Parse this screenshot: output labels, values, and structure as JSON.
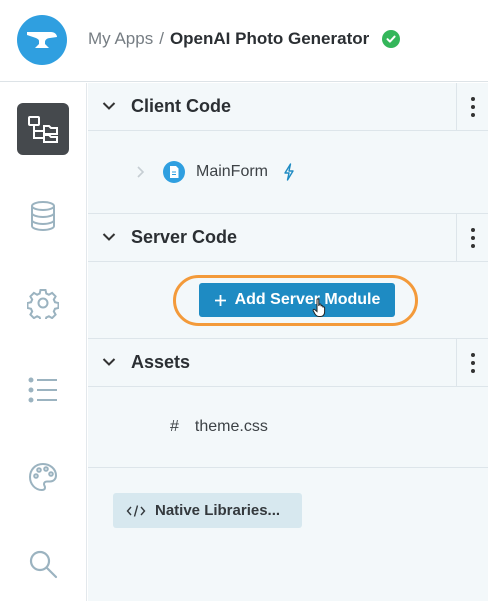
{
  "header": {
    "logo_icon": "anvil-icon",
    "breadcrumb_parent": "My Apps",
    "breadcrumb_separator": "/",
    "app_name": "OpenAI Photo Generator",
    "status_icon": "check-circle-icon",
    "status_color": "#34b65a"
  },
  "sidebar": {
    "items": [
      {
        "icon": "app-tree-icon",
        "active": true
      },
      {
        "icon": "database-icon",
        "active": false
      },
      {
        "icon": "gear-icon",
        "active": false
      },
      {
        "icon": "list-icon",
        "active": false
      },
      {
        "icon": "palette-icon",
        "active": false
      },
      {
        "icon": "search-icon",
        "active": false
      }
    ]
  },
  "sections": {
    "client_code": {
      "title": "Client Code",
      "items": [
        {
          "label": "MainForm",
          "icon": "form-icon",
          "startup_icon": "lightning-icon"
        }
      ]
    },
    "server_code": {
      "title": "Server Code",
      "add_button_label": "+ Add Server Module",
      "add_button_text": "Add Server Module"
    },
    "assets": {
      "title": "Assets",
      "items": [
        {
          "prefix": "#",
          "label": "theme.css"
        }
      ]
    }
  },
  "native_libraries": {
    "label": "Native Libraries...",
    "icon": "code-icon"
  },
  "colors": {
    "accent": "#1e8bc3",
    "highlight": "#f39a3a",
    "logo": "#2f9fe0"
  }
}
